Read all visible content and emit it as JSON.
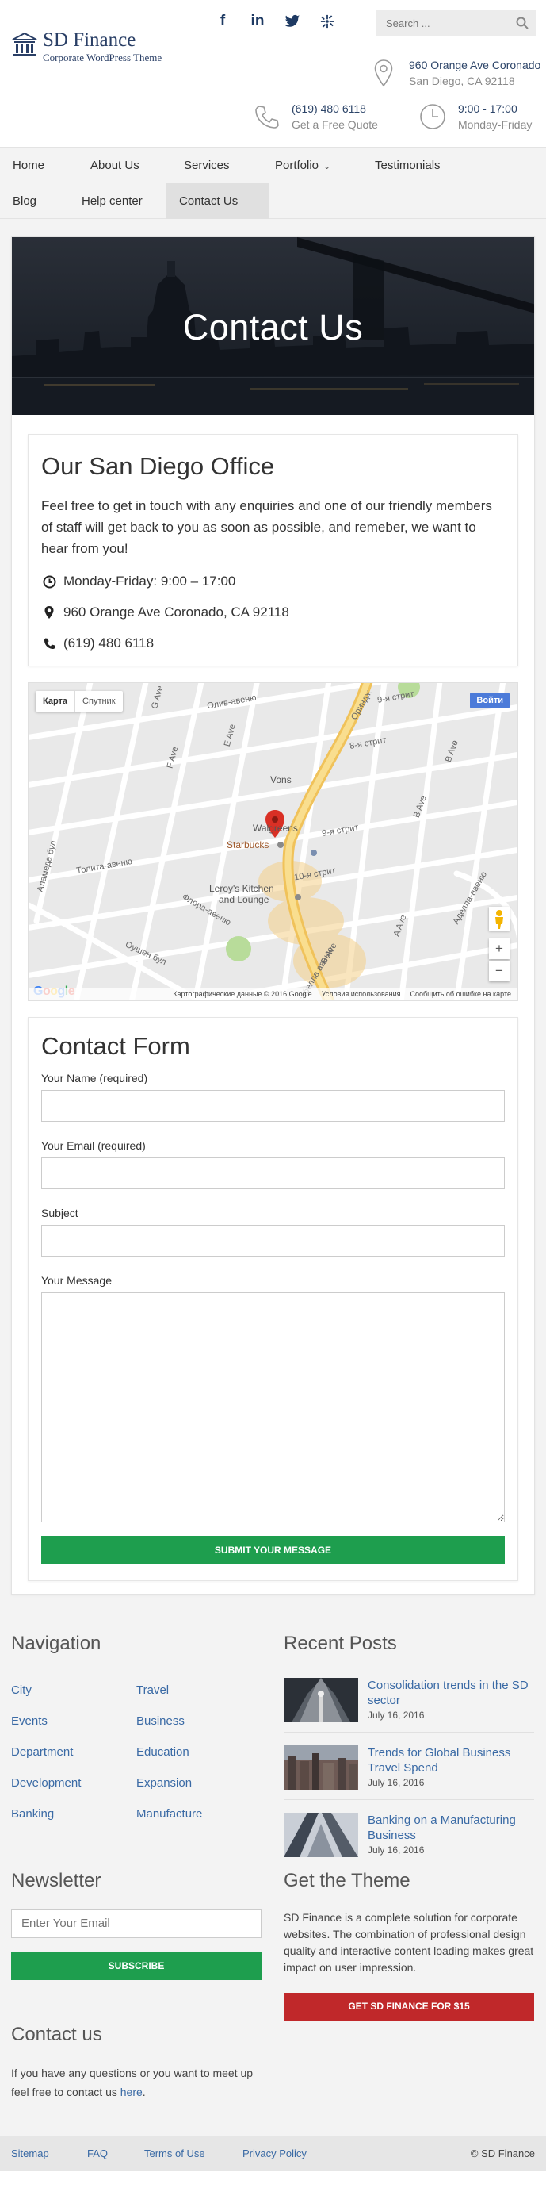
{
  "brand": {
    "title": "SD Finance",
    "subtitle": "Corporate WordPress Theme"
  },
  "social": [
    {
      "icon": "facebook-icon",
      "glyph": "f"
    },
    {
      "icon": "linkedin-icon",
      "glyph": "in"
    },
    {
      "icon": "twitter-icon",
      "glyph": "•"
    },
    {
      "icon": "yelp-icon",
      "glyph": "✱"
    }
  ],
  "search": {
    "placeholder": "Search ..."
  },
  "header_info": {
    "address_line1": "960 Orange Ave Coronado",
    "address_line2": "San Diego, CA 92118",
    "phone_line1": "(619) 480 6118",
    "phone_line2": "Get a Free Quote",
    "hours_line1": "9:00 - 17:00",
    "hours_line2": "Monday-Friday"
  },
  "nav": {
    "items": [
      {
        "label": "Home"
      },
      {
        "label": "About Us"
      },
      {
        "label": "Services"
      },
      {
        "label": "Portfolio",
        "chevron": "⌄"
      },
      {
        "label": "Testimonials"
      },
      {
        "label": "Blog"
      },
      {
        "label": "Help center"
      },
      {
        "label": "Contact Us",
        "active": true
      }
    ]
  },
  "hero": {
    "title": "Contact Us"
  },
  "office": {
    "title": "Our San Diego Office",
    "intro": "Feel free to get in touch with any enquiries and one of our friendly members of staff will get back to you as soon as possible, and remeber, we want to hear from you!",
    "hours": "Monday-Friday: 9:00 – 17:00",
    "address": "960 Orange Ave Coronado, CA 92118",
    "phone": "(619) 480 6118"
  },
  "map": {
    "toggle_map": "Карта",
    "toggle_satellite": "Спутник",
    "login": "Войти",
    "streets": {
      "olive": "Олив-авеню",
      "orange": "Ориндж",
      "ninth": "9-я стрит",
      "eighth": "8-я стрит",
      "tenth": "10-я стрит",
      "tolita": "Толита-авеню",
      "flora": "Флора-авеню",
      "alameda": "Аламеда бул",
      "ocean": "Оушен бул",
      "adella": "Аделла-авеню",
      "isabella": "Исабелла авеню",
      "e_ave": "E Ave",
      "f_ave": "F Ave",
      "g_ave": "G Ave",
      "b_ave": "B Ave",
      "a_ave": "A Ave"
    },
    "places": {
      "vons": "Vons",
      "walgreens": "Walgreens",
      "starbucks": "Starbucks",
      "leroys_1": "Leroy's Kitchen",
      "leroys_2": "and Lounge"
    },
    "footer": {
      "data": "Картографические данные © 2016 Google",
      "terms": "Условия использования",
      "report": "Сообщить об ошибке на карте"
    },
    "google": "Google",
    "zoom_in": "+",
    "zoom_out": "−"
  },
  "contact_form": {
    "title": "Contact Form",
    "name_label": "Your Name (required)",
    "email_label": "Your Email (required)",
    "subject_label": "Subject",
    "message_label": "Your Message",
    "name_value": "",
    "email_value": "",
    "subject_value": "",
    "submit": "SUBMIT YOUR MESSAGE"
  },
  "footer": {
    "navigation_title": "Navigation",
    "nav_col1": [
      "City",
      "Events",
      "Department",
      "Development",
      "Banking"
    ],
    "nav_col2": [
      "Travel",
      "Business",
      "Education",
      "Expansion",
      "Manufacture"
    ],
    "recent_title": "Recent Posts",
    "posts": [
      {
        "title": "Consolidation trends in the SD sector",
        "date": "July 16, 2016"
      },
      {
        "title": "Trends for Global Business Travel Spend",
        "date": "July 16, 2016"
      },
      {
        "title": "Banking on a Manufacturing Business",
        "date": "July 16, 2016"
      }
    ],
    "newsletter_title": "Newsletter",
    "newsletter_placeholder": "Enter Your Email",
    "subscribe": "SUBSCRIBE",
    "theme_title": "Get the Theme",
    "theme_text": "SD Finance is a complete solution for corporate websites. The combination of professional design quality and interactive content loading makes great impact on user impression.",
    "theme_button": "GET SD FINANCE FOR $15",
    "contact_title": "Contact us",
    "contact_text": "If you have any questions or you want to meet up feel free to contact us",
    "contact_link": "here",
    "contact_end": "."
  },
  "bottom_bar": {
    "links": [
      "Sitemap",
      "FAQ",
      "Terms of Use",
      "Privacy Policy"
    ],
    "copyright": "© SD Finance"
  },
  "colors": {
    "brand_navy": "#2a3f66",
    "link_blue": "#3a6aa5",
    "button_green": "#1e9e4e",
    "button_red": "#c0282a",
    "map_pin_red": "#d93025"
  }
}
